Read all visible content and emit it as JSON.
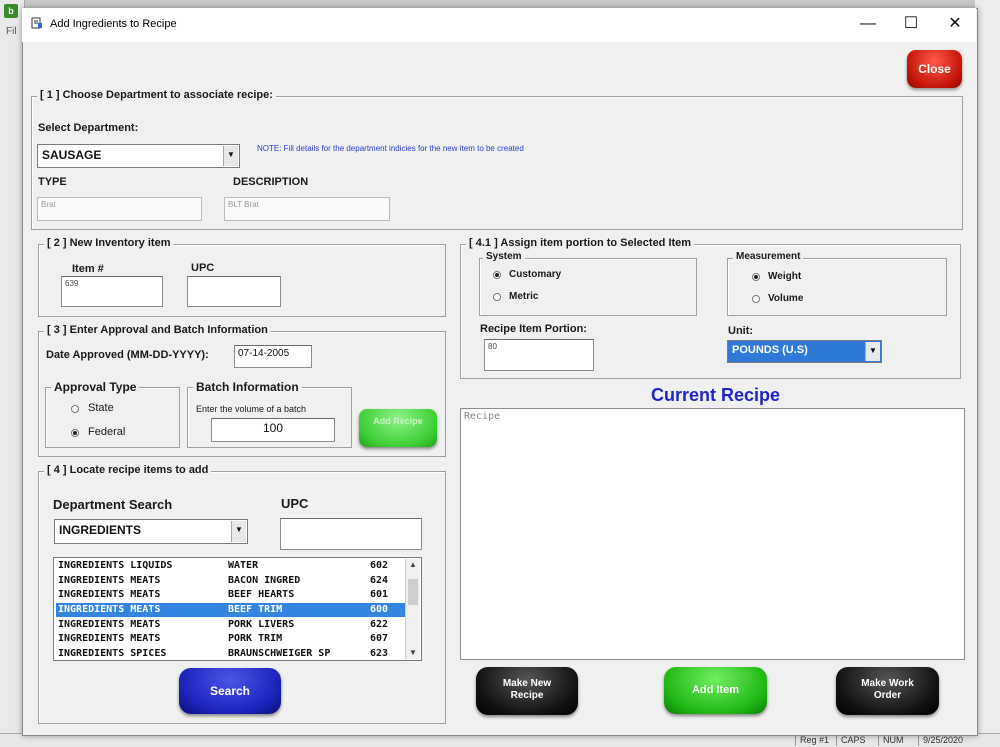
{
  "background_app": {
    "logo": "b",
    "menu_fragment": "Fil",
    "status": [
      "Reg #1",
      "CAPS",
      "NUM",
      "9/25/2020"
    ]
  },
  "window": {
    "title": "Add Ingredients to Recipe",
    "minimize": "—",
    "maximize": "☐",
    "close": "✕"
  },
  "close_button": "Close",
  "section1": {
    "legend": "[ 1 ] Choose Department  to associate recipe:",
    "select_label": "Select Department:",
    "department_value": "SAUSAGE",
    "note": "NOTE: Fill details for the department indicies for the new item to be created",
    "type_label": "TYPE",
    "type_value": "Brat",
    "description_label": "DESCRIPTION",
    "description_value": "BLT Brat"
  },
  "section2": {
    "legend": "[ 2 ] New Inventory item",
    "item_label": "Item #",
    "item_value": "639",
    "upc_label": "UPC",
    "upc_value": ""
  },
  "section3": {
    "legend": "[ 3 ] Enter Approval and Batch Information",
    "date_label": "Date Approved (MM-DD-YYYY):",
    "date_value": "07-14-2005",
    "approval_type_label": "Approval Type",
    "state_label": "State",
    "federal_label": "Federal",
    "approval_selected": "Federal",
    "batch_label": "Batch Information",
    "batch_hint": "Enter the volume of a batch",
    "batch_value": "100",
    "add_recipe_button": "Add Recipe"
  },
  "section4": {
    "legend": "[ 4 ] Locate recipe items to add",
    "dept_search_label": "Department Search",
    "dept_search_value": "INGREDIENTS",
    "upc_label": "UPC",
    "upc_value": "",
    "items": [
      {
        "category": "INGREDIENTS LIQUIDS",
        "name": "WATER",
        "code": "602",
        "selected": false
      },
      {
        "category": "INGREDIENTS MEATS",
        "name": "BACON INGRED",
        "code": "624",
        "selected": false
      },
      {
        "category": "INGREDIENTS MEATS",
        "name": "BEEF HEARTS",
        "code": "601",
        "selected": false
      },
      {
        "category": "INGREDIENTS MEATS",
        "name": "BEEF TRIM",
        "code": "600",
        "selected": true
      },
      {
        "category": "INGREDIENTS MEATS",
        "name": "PORK LIVERS",
        "code": "622",
        "selected": false
      },
      {
        "category": "INGREDIENTS MEATS",
        "name": "PORK TRIM",
        "code": "607",
        "selected": false
      },
      {
        "category": "INGREDIENTS SPICES",
        "name": "BRAUNSCHWEIGER SP",
        "code": "623",
        "selected": false
      }
    ],
    "search_button": "Search"
  },
  "section41": {
    "legend": "[ 4.1 ] Assign item portion to Selected Item",
    "system_label": "System",
    "customary_label": "Customary",
    "metric_label": "Metric",
    "system_selected": "Customary",
    "measurement_label": "Measurement",
    "weight_label": "Weight",
    "volume_label": "Volume",
    "measurement_selected": "Weight",
    "portion_label": "Recipe Item Portion:",
    "portion_value": "80",
    "unit_label": "Unit:",
    "unit_value": "POUNDS (U.S)"
  },
  "current_recipe": {
    "title": "Current Recipe",
    "placeholder": "Recipe"
  },
  "bottom_buttons": {
    "make_new_recipe": "Make New Recipe",
    "add_item": "Add Item",
    "make_work_order": "Make Work Order"
  },
  "icons": [
    "recipe-window-icon",
    "dropdown-arrow-icon",
    "scroll-up-icon",
    "scroll-down-icon"
  ],
  "colors": {
    "close_red": "#c4140a",
    "search_blue": "#1a22b8",
    "add_item_green": "#20b814",
    "current_recipe_blue": "#1f26c8",
    "selection_blue": "#3385e0"
  }
}
